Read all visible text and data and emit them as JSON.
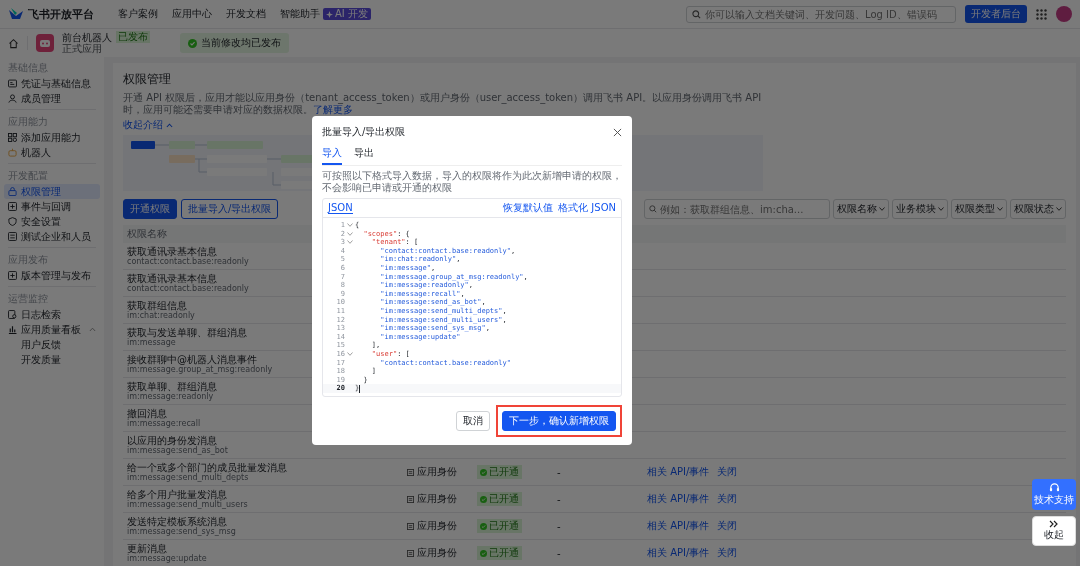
{
  "header": {
    "logo": "飞书开放平台",
    "nav": [
      {
        "label": "客户案例"
      },
      {
        "label": "应用中心"
      },
      {
        "label": "开发文档"
      },
      {
        "label": "智能助手",
        "badge": "AI 开发"
      }
    ],
    "search": {
      "placeholder": "你可以输入文档关键词、开发问题、Log ID、错误码"
    },
    "console_button": "开发者后台"
  },
  "app_bar": {
    "name": "前台机器人",
    "tag": "已发布",
    "subtitle": "正式应用",
    "status": "当前修改均已发布"
  },
  "sidebar": {
    "sections": [
      {
        "title": "基础信息",
        "items": [
          {
            "label": "凭证与基础信息",
            "kind": "card",
            "selected": false
          },
          {
            "label": "成员管理",
            "kind": "person",
            "selected": false
          }
        ]
      },
      {
        "title": "应用能力",
        "items": [
          {
            "label": "添加应用能力",
            "kind": "grid",
            "selected": false
          },
          {
            "label": "机器人",
            "kind": "robot",
            "selected": false
          }
        ]
      },
      {
        "title": "开发配置",
        "items": [
          {
            "label": "权限管理",
            "kind": "lock",
            "selected": true
          },
          {
            "label": "事件与回调",
            "kind": "plus",
            "selected": false
          },
          {
            "label": "安全设置",
            "kind": "shield",
            "selected": false
          },
          {
            "label": "测试企业和人员",
            "kind": "building",
            "selected": false
          }
        ]
      },
      {
        "title": "应用发布",
        "items": [
          {
            "label": "版本管理与发布",
            "kind": "plus",
            "selected": false
          }
        ]
      },
      {
        "title": "运营监控",
        "items": [
          {
            "label": "日志检索",
            "kind": "log",
            "selected": false
          },
          {
            "label": "应用质量看板",
            "kind": "chart",
            "selected": false,
            "expanded": true,
            "children": [
              {
                "label": "用户反馈",
                "selected": false
              },
              {
                "label": "开发质量",
                "selected": false
              }
            ]
          }
        ]
      }
    ]
  },
  "page": {
    "title": "权限管理",
    "description": "开通 API 权限后，应用才能以应用身份（tenant_access_token）或用户身份（user_access_token）调用飞书 API。以应用身份调用飞书 API 时，应用可能还需要申请对应的数据权限。",
    "learn_more": "了解更多",
    "collapse": "收起介绍",
    "buttons": [
      {
        "label": "开通权限",
        "kind": "primary"
      },
      {
        "label": "批量导入/导出权限",
        "kind": "outline"
      }
    ],
    "filter": {
      "placeholder": "例如：获取群组信息、im:cha...",
      "dropdowns": [
        "权限名称",
        "业务模块",
        "权限类型",
        "权限状态"
      ]
    },
    "table": {
      "columns": [
        "权限名称"
      ],
      "rows": [
        {
          "name": "获取通讯录基本信息",
          "scope": "contact:contact.base:readonly"
        },
        {
          "name": "获取通讯录基本信息",
          "scope": "contact:contact.base:readonly"
        },
        {
          "name": "获取群组信息",
          "scope": "im:chat:readonly"
        },
        {
          "name": "获取与发送单聊、群组消息",
          "scope": "im:message"
        },
        {
          "name": "接收群聊中@机器人消息事件",
          "scope": "im:message.group_at_msg:readonly"
        },
        {
          "name": "获取单聊、群组消息",
          "scope": "im:message:readonly"
        },
        {
          "name": "撤回消息",
          "scope": "im:message:recall"
        },
        {
          "name": "以应用的身份发消息",
          "scope": "im:message:send_as_bot"
        },
        {
          "name": "给一个或多个部门的成员批量发消息",
          "scope": "im:message:send_multi_depts",
          "identity": "应用身份",
          "status": "已开通",
          "column_4": "-",
          "actions": [
            "相关 API/事件",
            "关闭"
          ]
        },
        {
          "name": "给多个用户批量发消息",
          "scope": "im:message:send_multi_users",
          "identity": "应用身份",
          "status": "已开通",
          "column_4": "-",
          "actions": [
            "相关 API/事件",
            "关闭"
          ]
        },
        {
          "name": "发送特定模板系统消息",
          "scope": "im:message:send_sys_msg",
          "identity": "应用身份",
          "status": "已开通",
          "column_4": "-",
          "actions": [
            "相关 API/事件",
            "关闭"
          ]
        },
        {
          "name": "更新消息",
          "scope": "im:message:update",
          "identity": "应用身份",
          "status": "已开通",
          "column_4": "-",
          "actions": [
            "相关 API/事件",
            "关闭"
          ]
        }
      ]
    }
  },
  "modal": {
    "title": "批量导入/导出权限",
    "tabs": [
      {
        "label": "导入",
        "selected": true
      },
      {
        "label": "导出",
        "selected": false
      }
    ],
    "hint": "可按照以下格式导入数据，导入的权限将作为此次新增申请的权限，不会影响已申请或开通的权限",
    "editor": {
      "tab": "JSON",
      "actions": [
        "恢复默认值",
        "格式化 JSON"
      ],
      "lines": [
        {
          "number": "1",
          "text": "{",
          "foldable": true,
          "active": false
        },
        {
          "number": "2",
          "text": "  \"scopes\": {",
          "foldable": true,
          "active": false
        },
        {
          "number": "3",
          "text": "    \"tenant\": [",
          "foldable": true,
          "active": false
        },
        {
          "number": "4",
          "text": "      \"contact:contact.base:readonly\",",
          "foldable": false,
          "active": false
        },
        {
          "number": "5",
          "text": "      \"im:chat:readonly\",",
          "foldable": false,
          "active": false
        },
        {
          "number": "6",
          "text": "      \"im:message\",",
          "foldable": false,
          "active": false
        },
        {
          "number": "7",
          "text": "      \"im:message.group_at_msg:readonly\",",
          "foldable": false,
          "active": false
        },
        {
          "number": "8",
          "text": "      \"im:message:readonly\",",
          "foldable": false,
          "active": false
        },
        {
          "number": "9",
          "text": "      \"im:message:recall\",",
          "foldable": false,
          "active": false
        },
        {
          "number": "10",
          "text": "      \"im:message:send_as_bot\",",
          "foldable": false,
          "active": false
        },
        {
          "number": "11",
          "text": "      \"im:message:send_multi_depts\",",
          "foldable": false,
          "active": false
        },
        {
          "number": "12",
          "text": "      \"im:message:send_multi_users\",",
          "foldable": false,
          "active": false
        },
        {
          "number": "13",
          "text": "      \"im:message:send_sys_msg\",",
          "foldable": false,
          "active": false
        },
        {
          "number": "14",
          "text": "      \"im:message:update\"",
          "foldable": false,
          "active": false
        },
        {
          "number": "15",
          "text": "    ],",
          "foldable": false,
          "active": false
        },
        {
          "number": "16",
          "text": "    \"user\": [",
          "foldable": true,
          "active": false
        },
        {
          "number": "17",
          "text": "      \"contact:contact.base:readonly\"",
          "foldable": false,
          "active": false
        },
        {
          "number": "18",
          "text": "    ]",
          "foldable": false,
          "active": false
        },
        {
          "number": "19",
          "text": "  }",
          "foldable": false,
          "active": false
        },
        {
          "number": "20",
          "text": "}",
          "foldable": false,
          "active": true
        }
      ]
    },
    "buttons": [
      {
        "label": "取消",
        "kind": "secondary",
        "highlighted": false
      },
      {
        "label": "下一步，确认新增权限",
        "kind": "primary",
        "highlighted": true
      }
    ]
  },
  "floating": {
    "support": "技术支持",
    "collapse": "收起"
  }
}
